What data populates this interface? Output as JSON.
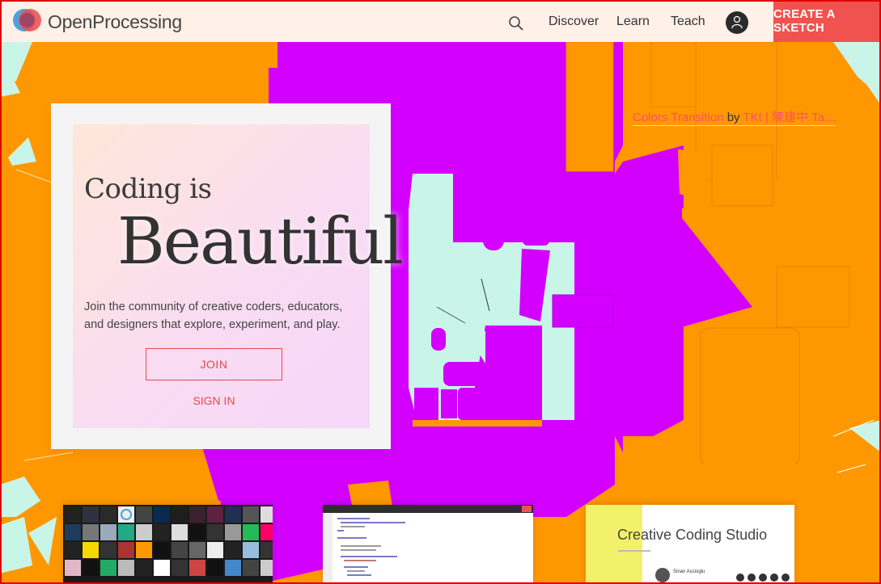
{
  "header": {
    "brand": "OpenProcessing",
    "nav": {
      "discover": "Discover",
      "learn": "Learn",
      "teach": "Teach"
    },
    "create_label": "CREATE A SKETCH",
    "icons": {
      "logo": "openprocessing-logo-icon",
      "search": "search-icon",
      "user": "user-icon"
    }
  },
  "credit": {
    "title": "Colors Transition",
    "by": "by",
    "author": "TKt | 陳建中 Ta…"
  },
  "hero": {
    "line1": "Coding is",
    "line2": "Beautiful",
    "description": "Join the community of creative coders, educators, and designers that explore, experiment, and play.",
    "join_label": "JOIN",
    "signin_label": "SIGN IN"
  },
  "previews": {
    "studio_title": "Creative Coding Studio",
    "studio_person": "Sinan Ascioglu"
  },
  "colors": {
    "orange": "#ff9800",
    "magenta": "#d400ff",
    "mint": "#c8f5e8",
    "accent_red": "#f0534f"
  }
}
